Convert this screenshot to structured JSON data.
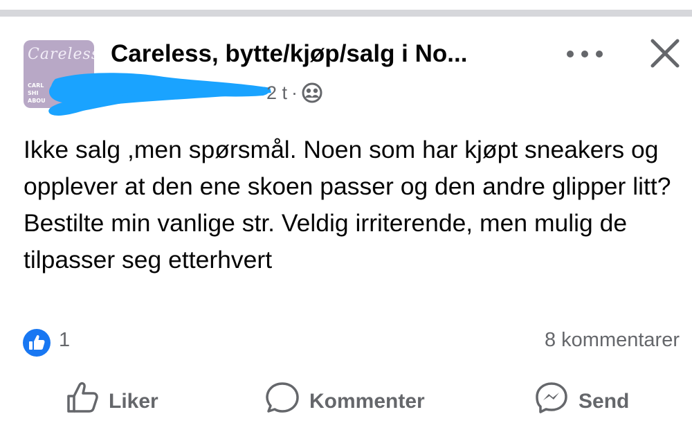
{
  "post": {
    "group_name": "Careless, bytte/kjøp/salg i No...",
    "avatar_script": "Careless",
    "avatar_lines": [
      "CARL",
      "SHI",
      "ABOU"
    ],
    "time": "2 t",
    "separator": "·",
    "privacy_icon": "group-icon",
    "text": "Ikke salg ,men spørsmål. Noen som har kjøpt sneakers og opplever at den ene skoen passer og den andre glipper litt? Bestilte min vanlige str. Veldig irriterende, men mulig de tilpasser seg etterhvert"
  },
  "stats": {
    "like_count": "1",
    "comments": "8 kommentarer"
  },
  "actions": {
    "like": "Liker",
    "comment": "Kommenter",
    "send": "Send"
  },
  "colors": {
    "text": "#050505",
    "secondary": "#65676b",
    "like_blue": "#1877f2",
    "scribble_blue": "#1aa3ff",
    "divider": "#d6d7db"
  }
}
